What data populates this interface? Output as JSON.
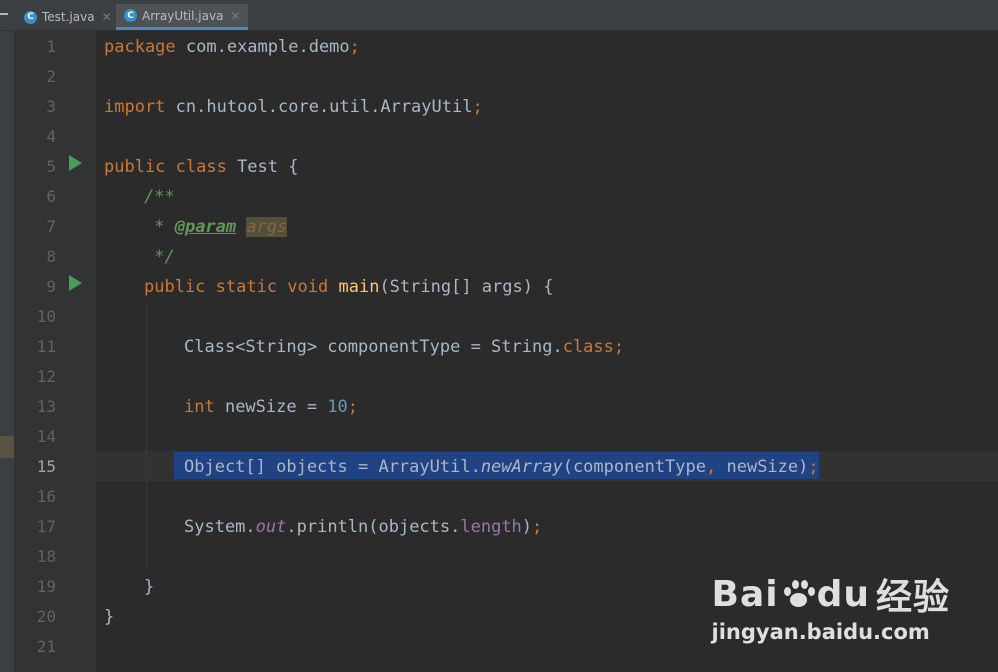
{
  "tabs": [
    {
      "label": "Test.java",
      "active": false,
      "icon": "java-class-icon"
    },
    {
      "label": "ArrayUtil.java",
      "active": true,
      "icon": "java-class-icon"
    }
  ],
  "editor": {
    "current_line": "15",
    "line_numbers": [
      "1",
      "2",
      "3",
      "4",
      "5",
      "6",
      "7",
      "8",
      "9",
      "10",
      "11",
      "12",
      "13",
      "14",
      "15",
      "16",
      "17",
      "18",
      "19",
      "20",
      "21"
    ],
    "code": {
      "l1": {
        "kw": "package",
        "rest": " com.example.demo",
        "semi": ";"
      },
      "l3": {
        "kw": "import",
        "rest": " cn.hutool.core.util.ArrayUtil",
        "semi": ";"
      },
      "l5": {
        "kw": "public class",
        "rest": " Test {"
      },
      "l6": {
        "doc": "/**"
      },
      "l7": {
        "star": " * ",
        "tag": "@param",
        "sp": " ",
        "arg": "args"
      },
      "l8": {
        "doc": " */"
      },
      "l9": {
        "kw": "public static void",
        "sp": " ",
        "fn": "main",
        "rest": "(String[] args) {"
      },
      "l11": {
        "pre": "Class<String> componentType = String.",
        "kw": "class",
        "semi": ";"
      },
      "l13": {
        "kw": "int",
        "mid": " newSize = ",
        "num": "10",
        "semi": ";"
      },
      "l15": {
        "pre": "Object[] objects = ArrayUtil.",
        "ital": "newArray",
        "post": "(componentType",
        "comma": ",",
        "post2": " newSize)",
        "semi": ";"
      },
      "l17": {
        "pre": "System.",
        "field": "out",
        "mid": ".println(objects.",
        "member": "length",
        "post": ")",
        "semi": ";"
      },
      "l19": {
        "brace": "}"
      },
      "l20": {
        "brace": "}"
      }
    }
  },
  "watermark": {
    "brand_a": "Bai",
    "brand_b": "du",
    "brand_cn": "经验",
    "url": "jingyan.baidu.com"
  },
  "colors": {
    "keyword": "#cc7832",
    "number": "#6897bb",
    "doc": "#629755",
    "function": "#ffc66d",
    "field": "#9876aa",
    "selection": "#214283",
    "run": "#499c54"
  }
}
